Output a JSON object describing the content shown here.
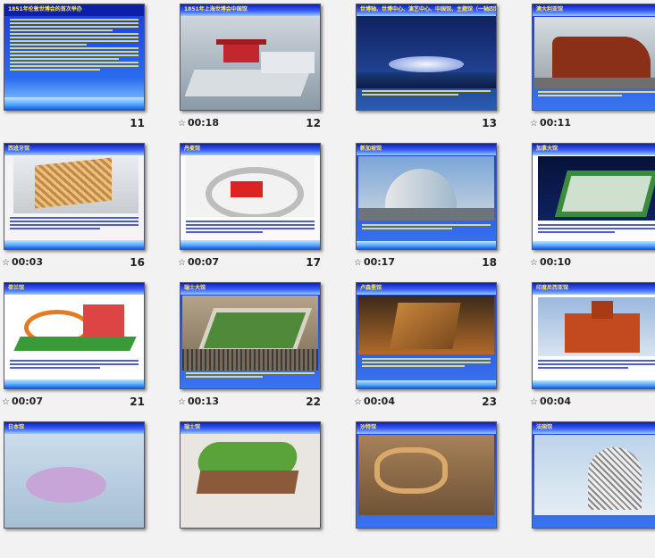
{
  "window": {
    "view": "slide-sorter"
  },
  "slides": [
    {
      "number": "11",
      "timing": "",
      "title": "1851年伦敦世博会的首次举办",
      "style": "text"
    },
    {
      "number": "12",
      "timing": "00:18",
      "title": "1851年上海世博会中国馆",
      "style": "photo"
    },
    {
      "number": "13",
      "timing": "",
      "title": "世博轴、世博中心、演艺中心、中国馆、主题馆（一轴四馆）",
      "style": "dark"
    },
    {
      "number": "",
      "timing": "00:11",
      "title": "澳大利亚馆",
      "style": "photo"
    },
    {
      "number": "16",
      "timing": "00:03",
      "title": "西班牙馆",
      "style": "photo"
    },
    {
      "number": "17",
      "timing": "00:07",
      "title": "丹麦馆",
      "style": "photo"
    },
    {
      "number": "18",
      "timing": "00:17",
      "title": "新加坡馆",
      "style": "photo"
    },
    {
      "number": "",
      "timing": "00:10",
      "title": "加拿大馆",
      "style": "dark"
    },
    {
      "number": "21",
      "timing": "00:07",
      "title": "荷兰馆",
      "style": "photo"
    },
    {
      "number": "22",
      "timing": "00:13",
      "title": "瑞士大馆",
      "style": "photo"
    },
    {
      "number": "23",
      "timing": "00:04",
      "title": "卢森堡馆",
      "style": "photo"
    },
    {
      "number": "",
      "timing": "00:04",
      "title": "印度尼西亚馆",
      "style": "photo"
    },
    {
      "number": "",
      "timing": "",
      "title": "日本馆",
      "style": "photo"
    },
    {
      "number": "",
      "timing": "",
      "title": "瑞士馆",
      "style": "photo"
    },
    {
      "number": "",
      "timing": "",
      "title": "沙特馆",
      "style": "photo"
    },
    {
      "number": "",
      "timing": "",
      "title": "法国馆",
      "style": "photo"
    }
  ]
}
